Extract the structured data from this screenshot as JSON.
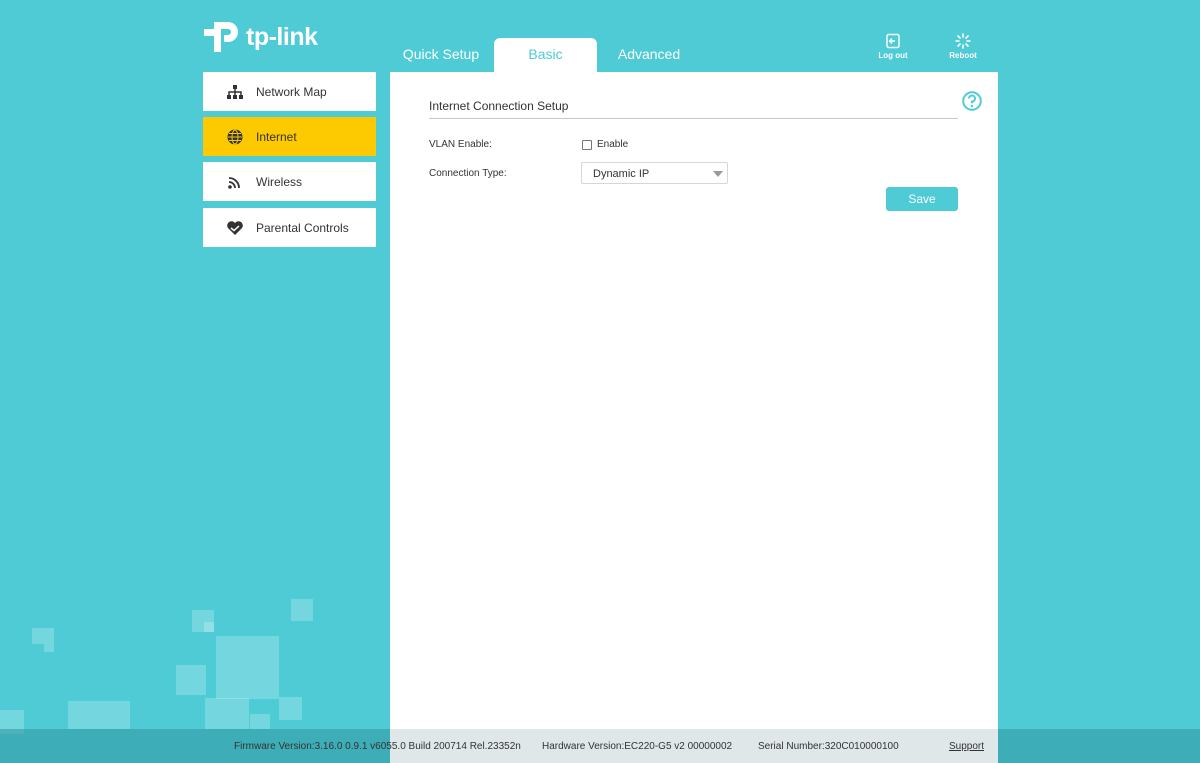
{
  "brand": {
    "logo_text": "tp-link"
  },
  "tabs": [
    {
      "label": "Quick Setup",
      "active": false
    },
    {
      "label": "Basic",
      "active": true
    },
    {
      "label": "Advanced",
      "active": false
    }
  ],
  "header_actions": {
    "logout": {
      "label": "Log out",
      "icon": "logout-icon"
    },
    "reboot": {
      "label": "Reboot",
      "icon": "reboot-icon"
    }
  },
  "sidebar": {
    "items": [
      {
        "label": "Network Map",
        "icon": "network-map-icon",
        "active": false
      },
      {
        "label": "Internet",
        "icon": "globe-icon",
        "active": true
      },
      {
        "label": "Wireless",
        "icon": "wifi-icon",
        "active": false
      },
      {
        "label": "Parental Controls",
        "icon": "parental-heart-icon",
        "active": false
      }
    ]
  },
  "main": {
    "section_title": "Internet Connection Setup",
    "vlan": {
      "label": "VLAN Enable:",
      "checkbox_label": "Enable",
      "checked": false
    },
    "connection_type": {
      "label": "Connection Type:",
      "value": "Dynamic IP"
    },
    "save_label": "Save",
    "help_icon": "help-icon"
  },
  "footer": {
    "firmware": "Firmware Version:3.16.0 0.9.1 v6055.0 Build 200714 Rel.23352n",
    "hardware": "Hardware Version:EC220-G5 v2 00000002",
    "serial": "Serial Number:320C010000100",
    "support": "Support"
  },
  "colors": {
    "background": "#4ecbd5",
    "accent": "#4ecbd5",
    "active_sidebar": "#fdc900",
    "panel": "#ffffff"
  }
}
